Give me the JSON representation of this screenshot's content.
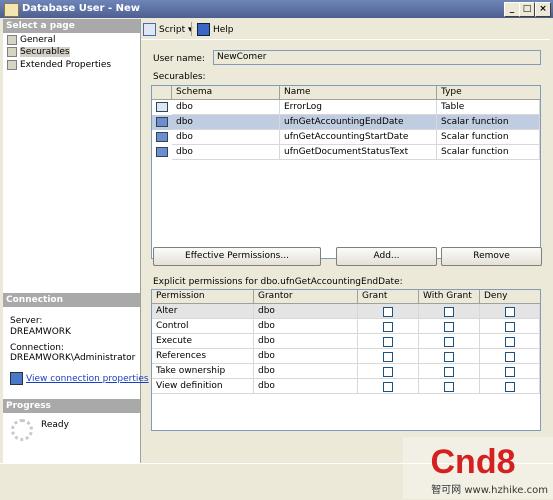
{
  "window": {
    "title": "Database User - New"
  },
  "sidebar": {
    "select_header": "Select a page",
    "items": [
      {
        "label": "General",
        "icon": "page-icon"
      },
      {
        "label": "Securables",
        "icon": "page-icon"
      },
      {
        "label": "Extended Properties",
        "icon": "page-icon"
      }
    ],
    "connection_header": "Connection",
    "server_label": "Server:",
    "server_value": "DREAMWORK",
    "connection_label": "Connection:",
    "connection_value": "DREAMWORK\\Administrator",
    "view_link": "View connection properties",
    "progress_header": "Progress",
    "progress_status": "Ready"
  },
  "toolbar": {
    "script": "Script",
    "help": "Help"
  },
  "main": {
    "user_name_label": "User name:",
    "user_name_value": "NewComer",
    "securables_label": "Securables:",
    "securables_columns": [
      "Schema",
      "Name",
      "Type"
    ],
    "securables_rows": [
      {
        "schema": "dbo",
        "name": "ErrorLog",
        "type": "Table",
        "icon": "table-icon"
      },
      {
        "schema": "dbo",
        "name": "ufnGetAccountingEndDate",
        "type": "Scalar function",
        "icon": "function-icon"
      },
      {
        "schema": "dbo",
        "name": "ufnGetAccountingStartDate",
        "type": "Scalar function",
        "icon": "function-icon"
      },
      {
        "schema": "dbo",
        "name": "ufnGetDocumentStatusText",
        "type": "Scalar function",
        "icon": "function-icon"
      }
    ],
    "selected_row": 1,
    "buttons": {
      "effective": "Effective Permissions...",
      "add": "Add...",
      "remove": "Remove"
    },
    "explicit_label": "Explicit permissions for dbo.ufnGetAccountingEndDate:",
    "permission_columns": [
      "Permission",
      "Grantor",
      "Grant",
      "With Grant",
      "Deny"
    ],
    "permission_rows": [
      {
        "permission": "Alter",
        "grantor": "dbo",
        "grant": false,
        "with_grant": false,
        "deny": false
      },
      {
        "permission": "Control",
        "grantor": "dbo",
        "grant": false,
        "with_grant": false,
        "deny": false
      },
      {
        "permission": "Execute",
        "grantor": "dbo",
        "grant": false,
        "with_grant": false,
        "deny": false
      },
      {
        "permission": "References",
        "grantor": "dbo",
        "grant": false,
        "with_grant": false,
        "deny": false
      },
      {
        "permission": "Take ownership",
        "grantor": "dbo",
        "grant": false,
        "with_grant": false,
        "deny": false
      },
      {
        "permission": "View definition",
        "grantor": "dbo",
        "grant": false,
        "with_grant": false,
        "deny": false
      }
    ]
  },
  "watermark": {
    "logo_text": "Cnd8",
    "site": "智可网 www.hzhike.com"
  }
}
